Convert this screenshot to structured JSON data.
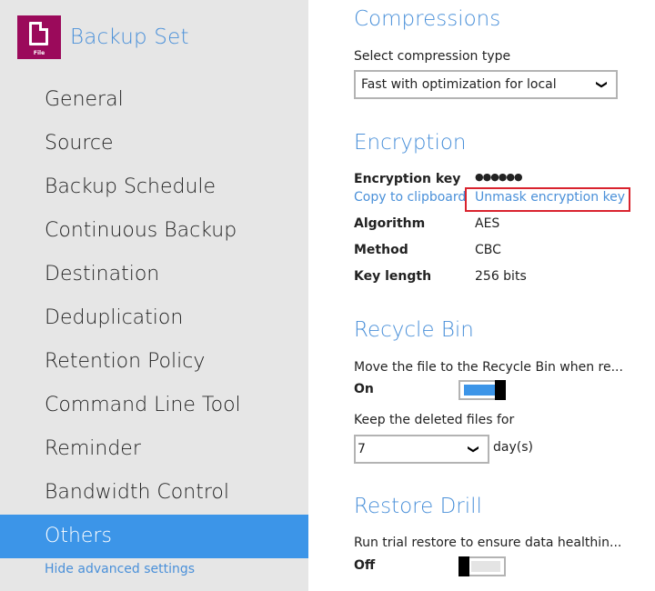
{
  "sidebar": {
    "brand": {
      "icon_label": "File",
      "title": "Backup Set",
      "icon_color": "#9b0a5b"
    },
    "items": [
      {
        "label": "General",
        "active": false
      },
      {
        "label": "Source",
        "active": false
      },
      {
        "label": "Backup Schedule",
        "active": false
      },
      {
        "label": "Continuous Backup",
        "active": false
      },
      {
        "label": "Destination",
        "active": false
      },
      {
        "label": "Deduplication",
        "active": false
      },
      {
        "label": "Retention Policy",
        "active": false
      },
      {
        "label": "Command Line Tool",
        "active": false
      },
      {
        "label": "Reminder",
        "active": false
      },
      {
        "label": "Bandwidth Control",
        "active": false
      },
      {
        "label": "Others",
        "active": true
      }
    ],
    "hide_advanced_label": "Hide advanced settings",
    "active_color": "#3c95e8"
  },
  "compressions": {
    "title": "Compressions",
    "select_label": "Select compression type",
    "selected_value": "Fast with optimization for local"
  },
  "encryption": {
    "title": "Encryption",
    "key_label": "Encryption key",
    "key_value": "●●●●●●",
    "copy_link": "Copy to clipboard",
    "unmask_link": "Unmask encryption key",
    "algorithm_label": "Algorithm",
    "algorithm_value": "AES",
    "method_label": "Method",
    "method_value": "CBC",
    "key_length_label": "Key length",
    "key_length_value": "256 bits",
    "highlight_color": "#d9232e"
  },
  "recycle_bin": {
    "title": "Recycle Bin",
    "description": "Move the file to the Recycle Bin when re...",
    "state_label": "On",
    "enabled": true,
    "keep_label": "Keep the deleted files for",
    "keep_value": "7",
    "unit": "day(s)"
  },
  "restore_drill": {
    "title": "Restore Drill",
    "description": "Run trial restore to ensure data healthin...",
    "state_label": "Off",
    "enabled": false
  },
  "icons": {
    "chevron": "❯"
  }
}
